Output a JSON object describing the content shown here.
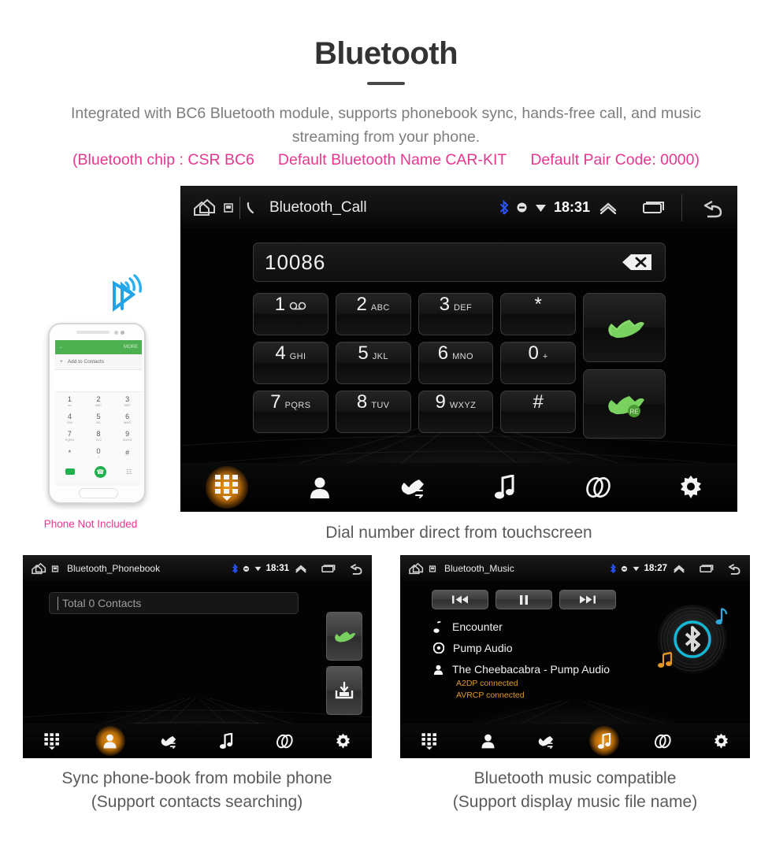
{
  "header": {
    "title": "Bluetooth",
    "description": "Integrated with BC6 Bluetooth module, supports phonebook sync, hands-free call, and music streaming from your phone.",
    "specs": [
      "(Bluetooth chip : CSR BC6",
      "Default Bluetooth Name CAR-KIT",
      "Default Pair Code: 0000)"
    ],
    "accent_color": "#e8368f",
    "title_color": "#333333",
    "description_color": "#7d7d7d"
  },
  "phone_mock": {
    "caption": "Phone Not Included",
    "topbar_action": "MORE",
    "add_contacts": "Add to Contacts",
    "keys": [
      {
        "digit": "1",
        "letters": "oo"
      },
      {
        "digit": "2",
        "letters": "ABC"
      },
      {
        "digit": "3",
        "letters": "DEF"
      },
      {
        "digit": "4",
        "letters": "GHI"
      },
      {
        "digit": "5",
        "letters": "JKL"
      },
      {
        "digit": "6",
        "letters": "MNO"
      },
      {
        "digit": "7",
        "letters": "PQRS"
      },
      {
        "digit": "8",
        "letters": "TUV"
      },
      {
        "digit": "9",
        "letters": "WXYZ"
      },
      {
        "digit": "*",
        "letters": ""
      },
      {
        "digit": "0",
        "letters": "+"
      },
      {
        "digit": "#",
        "letters": ""
      }
    ]
  },
  "dialer": {
    "statusbar": {
      "title": "Bluetooth_Call",
      "time": "18:31",
      "icons": [
        "home-icon",
        "sd-card-icon",
        "phone-icon",
        "bluetooth-icon",
        "mute-icon",
        "wifi-icon",
        "chevron-up-icon",
        "recents-icon",
        "back-icon"
      ]
    },
    "number": "10086",
    "backspace_label": "backspace-icon",
    "keys": [
      {
        "digit": "1",
        "letters": "voicemail"
      },
      {
        "digit": "2",
        "letters": "ABC"
      },
      {
        "digit": "3",
        "letters": "DEF"
      },
      {
        "digit": "*",
        "letters": ""
      },
      {
        "digit": "4",
        "letters": "GHI"
      },
      {
        "digit": "5",
        "letters": "JKL"
      },
      {
        "digit": "6",
        "letters": "MNO"
      },
      {
        "digit": "0",
        "letters": "+"
      },
      {
        "digit": "7",
        "letters": "PQRS"
      },
      {
        "digit": "8",
        "letters": "TUV"
      },
      {
        "digit": "9",
        "letters": "WXYZ"
      },
      {
        "digit": "#",
        "letters": ""
      }
    ],
    "call_button": "call-icon",
    "redial_button": "redial-icon",
    "redial_badge": "RE",
    "nav": [
      {
        "name": "keypad",
        "icon": "keypad-icon",
        "active": true
      },
      {
        "name": "contacts",
        "icon": "contact-icon",
        "active": false
      },
      {
        "name": "call-log",
        "icon": "call-log-icon",
        "active": false
      },
      {
        "name": "music",
        "icon": "music-note-icon",
        "active": false
      },
      {
        "name": "pair",
        "icon": "link-icon",
        "active": false
      },
      {
        "name": "settings",
        "icon": "gear-icon",
        "active": false
      }
    ],
    "caption": "Dial number direct from touchscreen"
  },
  "phonebook": {
    "statusbar": {
      "title": "Bluetooth_Phonebook",
      "time": "18:31"
    },
    "search_value": "Total 0 Contacts",
    "search_placeholder": "Total 0 Contacts",
    "call_button": "call-icon",
    "download_button": "download-contacts-icon",
    "nav": [
      {
        "name": "keypad",
        "icon": "keypad-icon",
        "active": false
      },
      {
        "name": "contacts",
        "icon": "contact-icon",
        "active": true
      },
      {
        "name": "call-log",
        "icon": "call-log-icon",
        "active": false
      },
      {
        "name": "music",
        "icon": "music-note-icon",
        "active": false
      },
      {
        "name": "pair",
        "icon": "link-icon",
        "active": false
      },
      {
        "name": "settings",
        "icon": "gear-icon",
        "active": false
      }
    ],
    "caption_line1": "Sync phone-book from mobile phone",
    "caption_line2": "(Support contacts searching)"
  },
  "music": {
    "statusbar": {
      "title": "Bluetooth_Music",
      "time": "18:27"
    },
    "transport": [
      {
        "name": "previous",
        "icon": "skip-previous-icon"
      },
      {
        "name": "pause",
        "icon": "pause-icon"
      },
      {
        "name": "next",
        "icon": "skip-next-icon"
      }
    ],
    "track": {
      "title": "Encounter",
      "album": "Pump Audio",
      "artist": "The Cheebacabra - Pump Audio"
    },
    "status_lines": [
      "A2DP connected",
      "AVRCP connected"
    ],
    "status_color": "#e09a28",
    "album_art": "bluetooth-disc-icon",
    "nav": [
      {
        "name": "keypad",
        "icon": "keypad-icon",
        "active": false
      },
      {
        "name": "contacts",
        "icon": "contact-icon",
        "active": false
      },
      {
        "name": "call-log",
        "icon": "call-log-icon",
        "active": false
      },
      {
        "name": "music",
        "icon": "music-note-icon",
        "active": true
      },
      {
        "name": "pair",
        "icon": "link-icon",
        "active": false
      },
      {
        "name": "settings",
        "icon": "gear-icon",
        "active": false
      }
    ],
    "caption_line1": "Bluetooth music compatible",
    "caption_line2": "(Support display music file name)"
  }
}
